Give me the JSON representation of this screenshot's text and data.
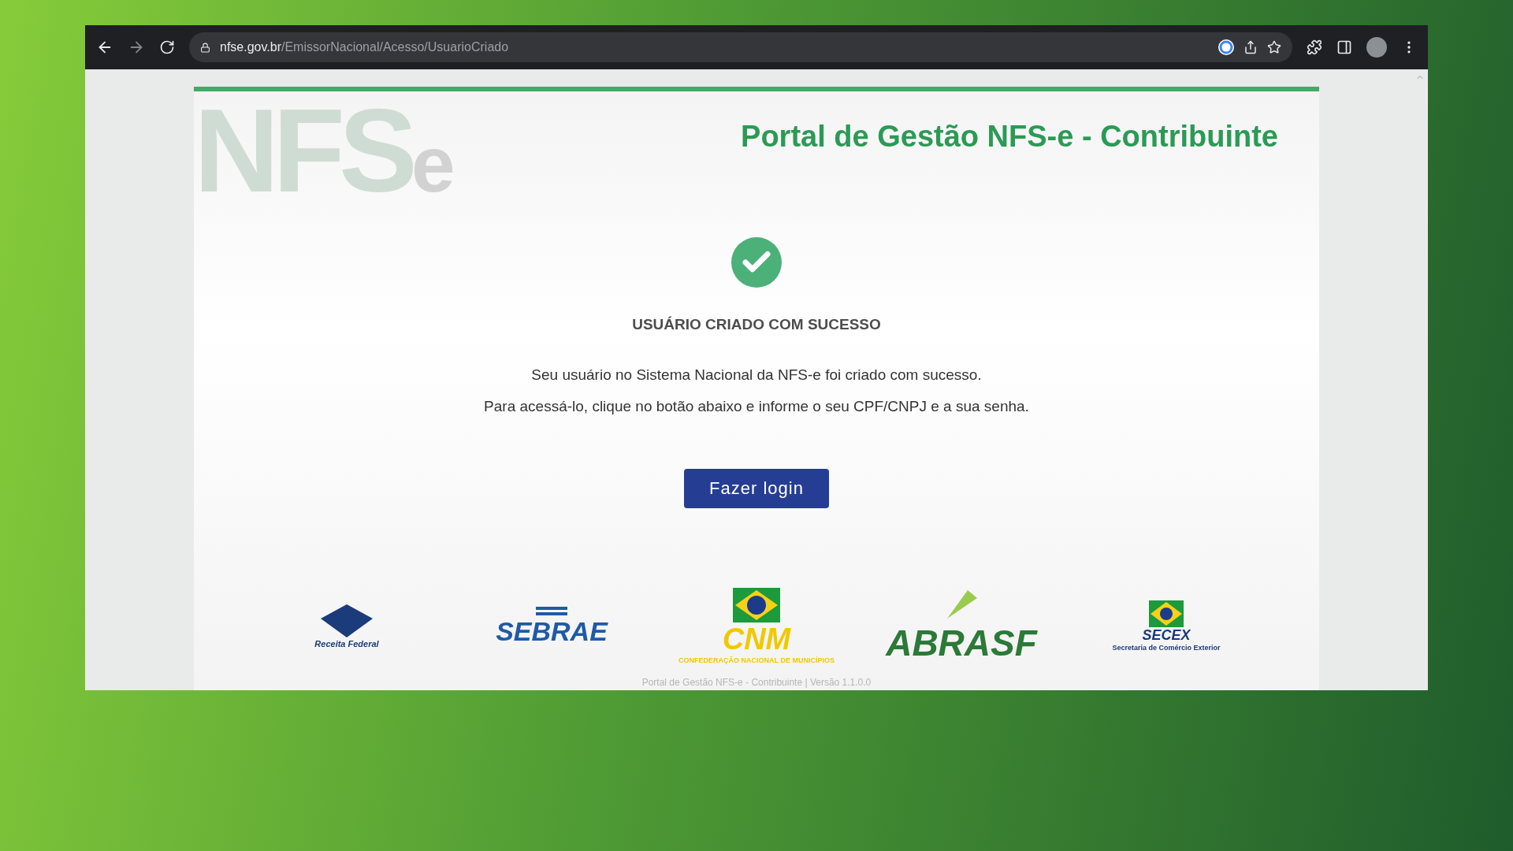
{
  "browser": {
    "url_host": "nfse.gov.br",
    "url_path": "/EmissorNacional/Acesso/UsuarioCriado"
  },
  "page": {
    "logo": {
      "main": "NFS",
      "suffix": "e"
    },
    "title": "Portal de Gestão NFS-e - Contribuinte",
    "heading": "USUÁRIO CRIADO COM SUCESSO",
    "message": [
      "Seu usuário no Sistema Nacional da NFS-e foi criado com sucesso.",
      "Para acessá-lo, clique no botão abaixo e informe o seu CPF/CNPJ e a sua senha."
    ],
    "button": "Fazer login",
    "partners": [
      {
        "kind": "receita",
        "name": "Receita Federal"
      },
      {
        "kind": "sebrae",
        "name": "SEBRAE"
      },
      {
        "kind": "cnm",
        "name": "CNM",
        "caption": "CONFEDERAÇÃO NACIONAL DE MUNICÍPIOS"
      },
      {
        "kind": "abrasf",
        "name": "ABRASF"
      },
      {
        "kind": "secex",
        "name": "SECEX",
        "caption": "Secretaria de Comércio Exterior"
      }
    ],
    "footer": "Portal de Gestão NFS-e - Contribuinte | Versão 1.1.0.0"
  }
}
